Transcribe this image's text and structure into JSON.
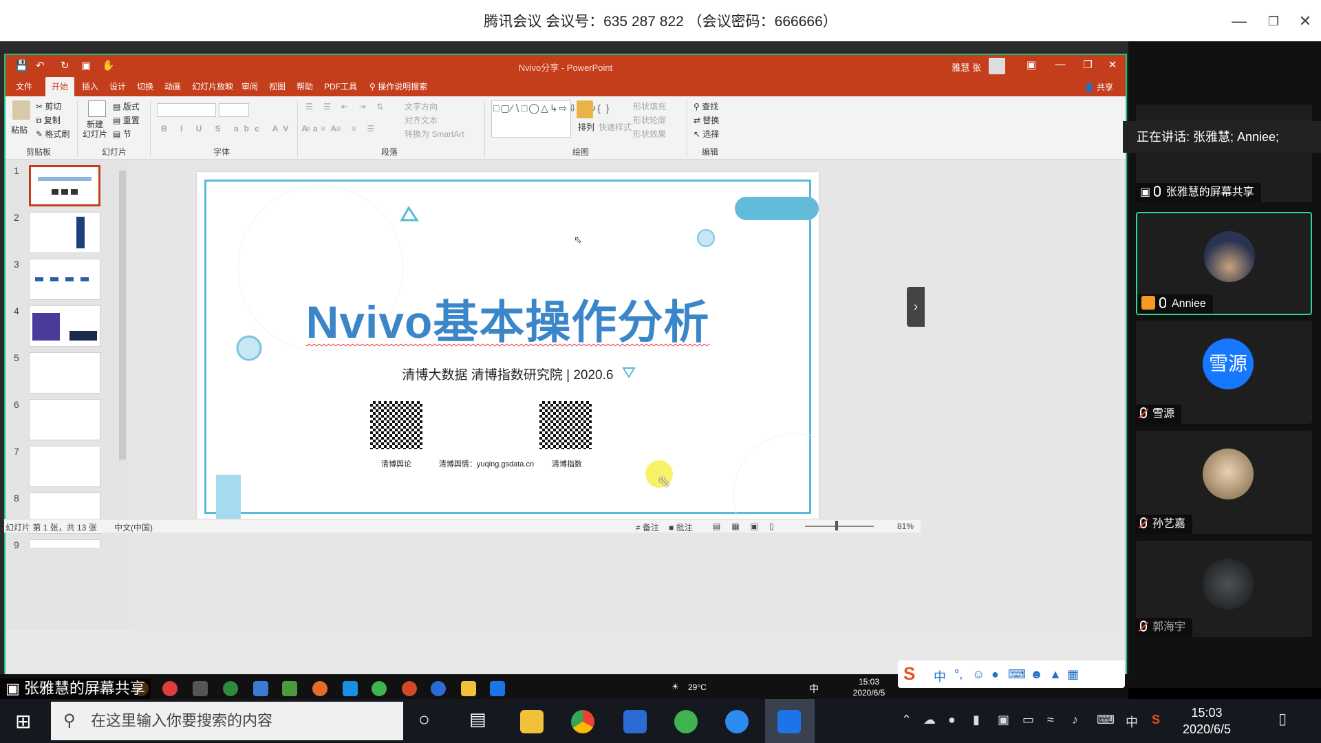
{
  "meeting": {
    "title": "腾讯会议 会议号：635 287 822 （会议密码：666666）",
    "speaking": "正在讲话: 张雅慧; Anniee;",
    "participants": [
      {
        "name": "张雅慧的屏幕共享"
      },
      {
        "name": "Anniee"
      },
      {
        "name": "雪源",
        "avatar_text": "雪源"
      },
      {
        "name": "孙艺嘉"
      },
      {
        "name": "郭海宇"
      }
    ],
    "share_caption": "张雅慧的屏幕共享"
  },
  "ppt": {
    "window_title": "Nvivo分享 - PowerPoint",
    "user": "雅慧 张",
    "tabs": [
      "文件",
      "开始",
      "插入",
      "设计",
      "切换",
      "动画",
      "幻灯片放映",
      "审阅",
      "视图",
      "帮助",
      "PDF工具",
      "操作说明搜索"
    ],
    "share": "共享",
    "ribbon": {
      "paste": "粘贴",
      "cut": "剪切",
      "copy": "复制",
      "format_painter": "格式刷",
      "new_slide": "新建\n幻灯片",
      "layout": "版式",
      "reset": "重置",
      "section": "节",
      "text_dir": "文字方向",
      "align_text": "对齐文本",
      "smartart": "转换为 SmartArt",
      "arrange": "排列",
      "quick_styles": "快速样式",
      "shape_fill": "形状填充",
      "shape_outline": "形状轮廓",
      "shape_effects": "形状效果",
      "find": "查找",
      "replace": "替换",
      "select": "选择",
      "groups": [
        "剪贴板",
        "幻灯片",
        "字体",
        "段落",
        "绘图",
        "编辑"
      ]
    },
    "slide": {
      "title": "Nvivo基本操作分析",
      "subtitle": "清博大数据 清博指数研究院 | 2020.6",
      "qr_labels": [
        "清博舆论",
        "清博舆情：yuqing.gsdata.cn",
        "清博指数"
      ]
    },
    "thumbnails": [
      "1",
      "2",
      "3",
      "4",
      "5",
      "6",
      "7",
      "8",
      "9"
    ],
    "status": {
      "slide_info": "幻灯片 第 1 张，共 13 张",
      "language": "中文(中国)",
      "notes": "备注",
      "comments": "批注",
      "zoom": "81%"
    }
  },
  "inner_taskbar": {
    "temp": "29°C",
    "ime": "中",
    "time": "15:03",
    "date": "2020/6/5"
  },
  "taskbar": {
    "search_placeholder": "在这里输入你要搜索的内容",
    "ime": "中",
    "time": "15:03",
    "date": "2020/6/5"
  },
  "colors": {
    "ppt_red": "#c43e1c",
    "title_blue": "#3a86c8",
    "frame_blue": "#5bb9d8",
    "active_green": "#2dd98f"
  }
}
